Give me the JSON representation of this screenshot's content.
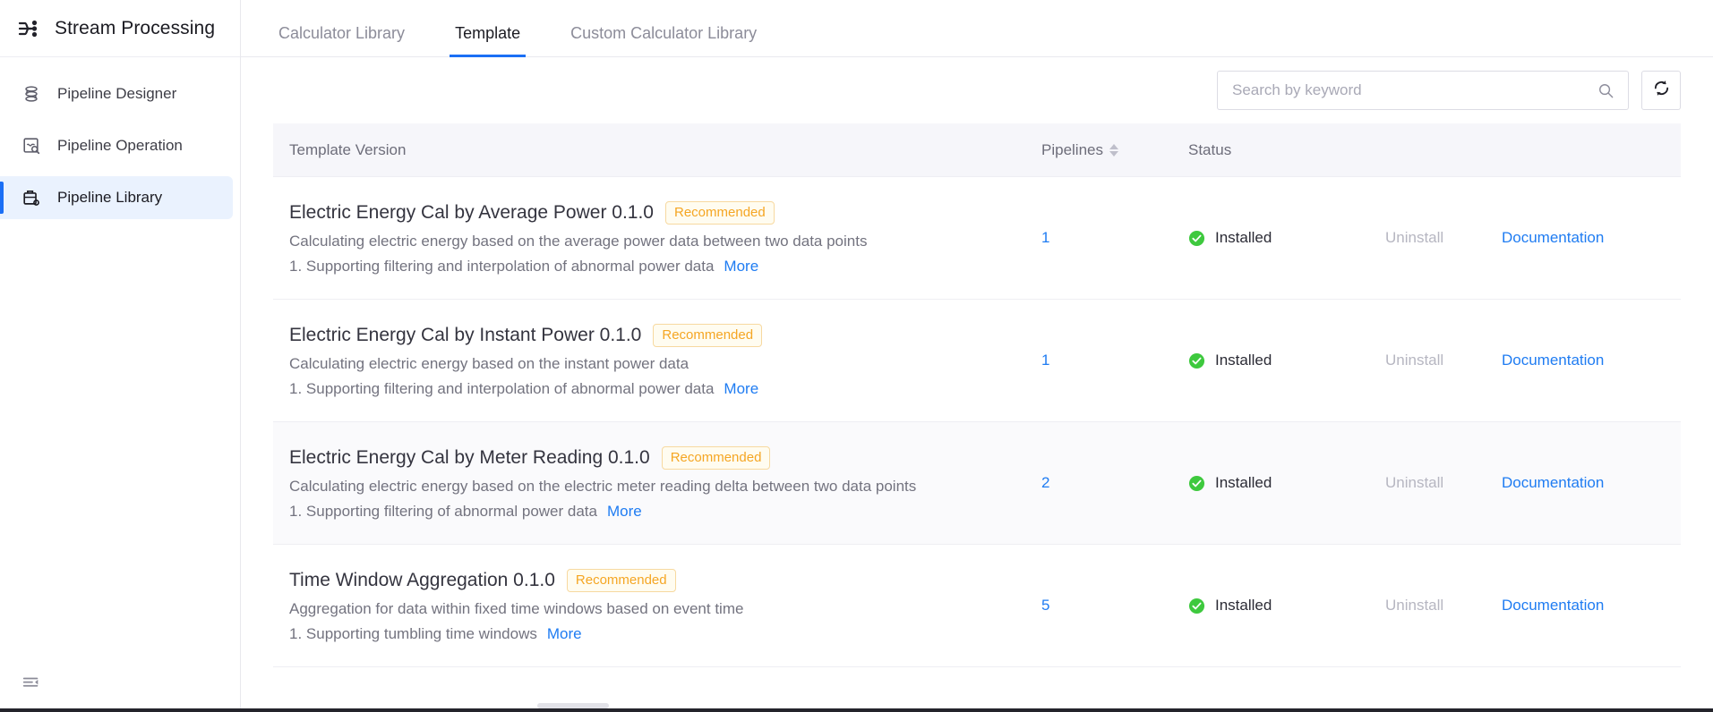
{
  "sidebar": {
    "brand": {
      "icon": "stream-processing-icon",
      "title": "Stream Processing"
    },
    "items": [
      {
        "icon": "pipeline-designer-icon",
        "label": "Pipeline Designer",
        "active": false
      },
      {
        "icon": "pipeline-operation-icon",
        "label": "Pipeline Operation",
        "active": false
      },
      {
        "icon": "pipeline-library-icon",
        "label": "Pipeline Library",
        "active": true
      }
    ],
    "collapse_icon": "menu-fold-icon"
  },
  "tabs": [
    {
      "label": "Calculator Library",
      "active": false
    },
    {
      "label": "Template",
      "active": true
    },
    {
      "label": "Custom Calculator Library",
      "active": false
    }
  ],
  "toolbar": {
    "search": {
      "value": "",
      "placeholder": "Search by keyword",
      "icon": "search-icon"
    },
    "refresh": {
      "icon": "refresh-icon",
      "label": ""
    }
  },
  "table": {
    "headers": {
      "name": "Template Version",
      "pipelines": "Pipelines",
      "status": "Status",
      "sort_icon": "sort-arrows-icon"
    },
    "rows": [
      {
        "title": "Electric Energy Cal by Average Power 0.1.0",
        "badge": "Recommended",
        "description": "Calculating electric energy based on the average power data between two data points",
        "feature": "1. Supporting filtering and interpolation of abnormal power data",
        "more": "More",
        "pipelines": "1",
        "status": "Installed",
        "status_icon": "check-circle-icon",
        "uninstall": "Uninstall",
        "documentation": "Documentation"
      },
      {
        "title": "Electric Energy Cal by Instant Power 0.1.0",
        "badge": "Recommended",
        "description": "Calculating electric energy based on the instant power data",
        "feature": "1. Supporting filtering and interpolation of abnormal power data",
        "more": "More",
        "pipelines": "1",
        "status": "Installed",
        "status_icon": "check-circle-icon",
        "uninstall": "Uninstall",
        "documentation": "Documentation"
      },
      {
        "title": "Electric Energy Cal by Meter Reading 0.1.0",
        "badge": "Recommended",
        "description": "Calculating electric energy based on the electric meter reading delta between two data points",
        "feature": "1. Supporting filtering of abnormal power data",
        "more": "More",
        "pipelines": "2",
        "status": "Installed",
        "status_icon": "check-circle-icon",
        "uninstall": "Uninstall",
        "documentation": "Documentation"
      },
      {
        "title": "Time Window Aggregation 0.1.0",
        "badge": "Recommended",
        "description": "Aggregation for data within fixed time windows based on event time",
        "feature": "1. Supporting tumbling time windows",
        "more": "More",
        "pipelines": "5",
        "status": "Installed",
        "status_icon": "check-circle-icon",
        "uninstall": "Uninstall",
        "documentation": "Documentation"
      }
    ]
  },
  "colors": {
    "accent": "#1b6ff5",
    "link": "#1f7cf2",
    "badge_text": "#f5a623",
    "badge_bg": "#fffcf0",
    "badge_border": "#f7d9a0",
    "status_ok": "#3ec93e",
    "active_nav_bg": "#eaf2fe",
    "header_bg": "#f6f6fa",
    "zebra_bg": "#fafafc"
  }
}
